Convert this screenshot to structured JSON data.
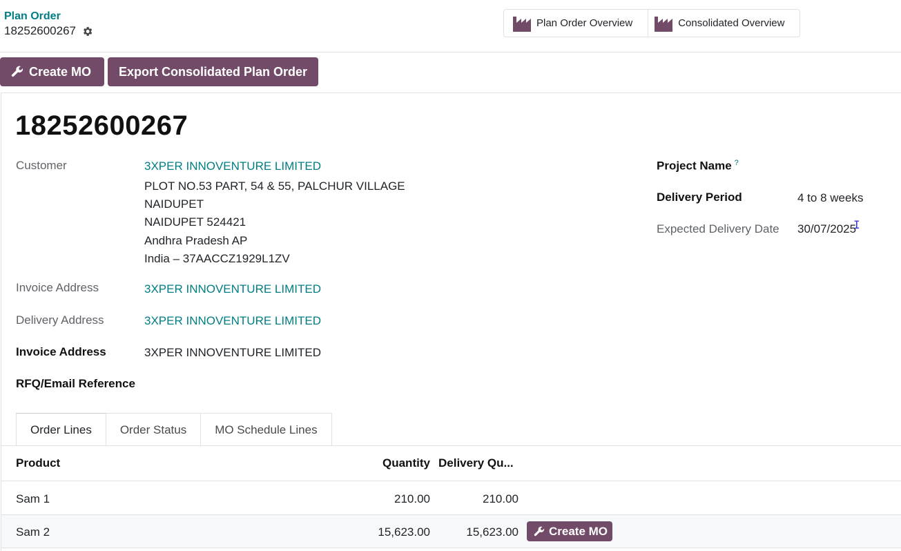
{
  "breadcrumb": {
    "parent": "Plan Order",
    "current": "18252600267"
  },
  "smart_buttons": [
    {
      "label": "Plan Order Overview",
      "icon": "factory-icon"
    },
    {
      "label": "Consolidated Overview",
      "icon": "factory-icon"
    }
  ],
  "actions": {
    "create_mo": "Create MO",
    "export": "Export Consolidated Plan Order"
  },
  "record": {
    "title": "18252600267",
    "customer_label": "Customer",
    "customer_name": "3XPER INNOVENTURE LIMITED",
    "customer_address": [
      "PLOT NO.53 PART, 54 & 55, PALCHUR VILLAGE",
      "NAIDUPET",
      "NAIDUPET 524421",
      "Andhra Pradesh AP",
      "India – 37AACCZ1929L1ZV"
    ],
    "invoice_address_label": "Invoice Address",
    "invoice_address_value": "3XPER INNOVENTURE LIMITED",
    "delivery_address_label": "Delivery Address",
    "delivery_address_value": "3XPER INNOVENTURE LIMITED",
    "invoice_address2_label": "Invoice Address",
    "invoice_address2_value": "3XPER INNOVENTURE LIMITED",
    "rfq_label": "RFQ/Email Reference",
    "project_name_label": "Project Name",
    "project_help": "?",
    "delivery_period_label": "Delivery Period",
    "delivery_period_value": "4 to 8 weeks",
    "expected_date_label": "Expected Delivery Date",
    "expected_date_value": "30/07/2025"
  },
  "tabs": [
    {
      "label": "Order Lines",
      "active": true
    },
    {
      "label": "Order Status",
      "active": false
    },
    {
      "label": "MO Schedule Lines",
      "active": false
    }
  ],
  "table": {
    "headers": {
      "product": "Product",
      "quantity": "Quantity",
      "delivery_qty": "Delivery Qu..."
    },
    "rows": [
      {
        "product": "Sam 1",
        "quantity": "210.00",
        "delivery_qty": "210.00"
      },
      {
        "product": "Sam 2",
        "quantity": "15,623.00",
        "delivery_qty": "15,623.00",
        "action": "Create MO"
      }
    ]
  },
  "colors": {
    "primary": "#714b67",
    "link": "#017e84",
    "border": "#dee2e6"
  }
}
